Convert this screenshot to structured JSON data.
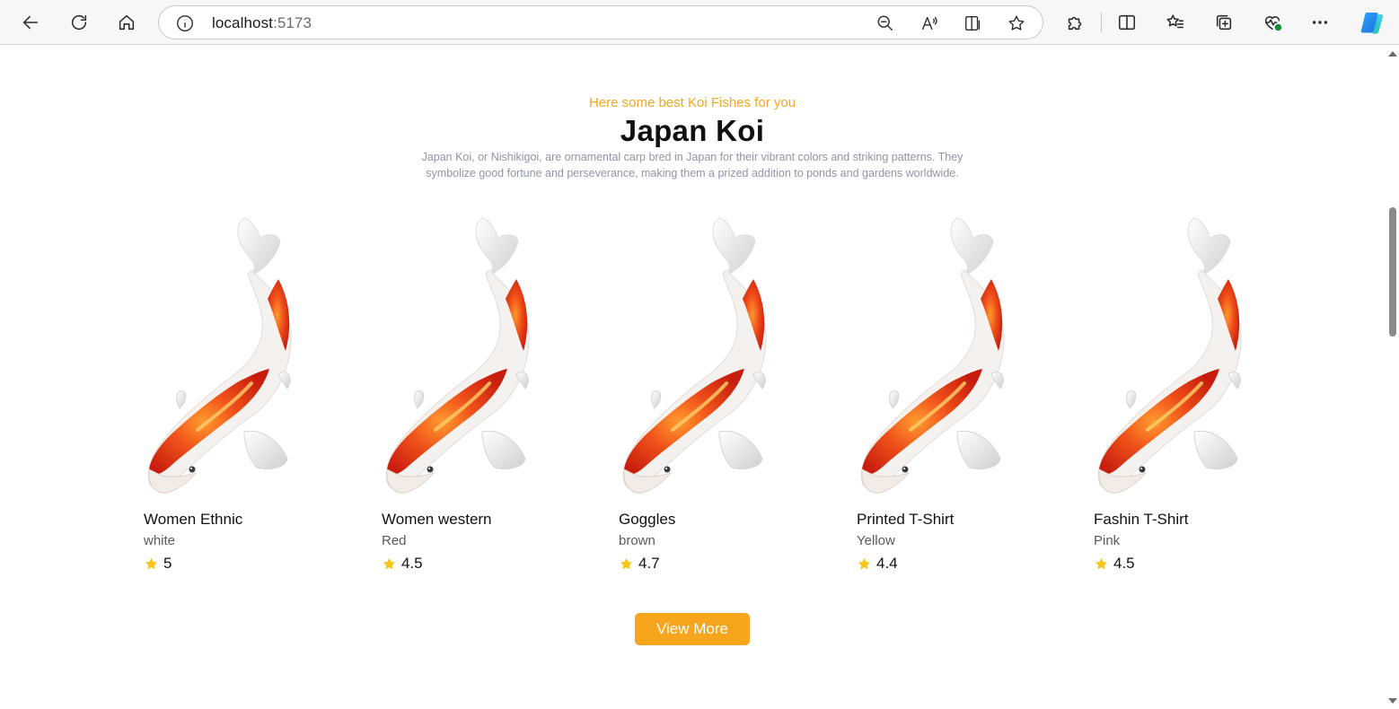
{
  "browser": {
    "url_host": "localhost",
    "url_port": ":5173"
  },
  "section": {
    "subtitle": "Here some best Koi Fishes for you",
    "title": "Japan Koi",
    "description": "Japan Koi, or Nishikigoi, are ornamental carp bred in Japan for their vibrant colors and striking patterns. They symbolize good fortune and perseverance, making them a prized addition to ponds and gardens worldwide."
  },
  "products": [
    {
      "name": "Women Ethnic",
      "color": "white",
      "rating": "5"
    },
    {
      "name": "Women western",
      "color": "Red",
      "rating": "4.5"
    },
    {
      "name": "Goggles",
      "color": "brown",
      "rating": "4.7"
    },
    {
      "name": "Printed T-Shirt",
      "color": "Yellow",
      "rating": "4.4"
    },
    {
      "name": "Fashin T-Shirt",
      "color": "Pink",
      "rating": "4.5"
    }
  ],
  "actions": {
    "view_more": "View More"
  },
  "colors": {
    "accent": "#f7a51c",
    "subtitle": "#f5a623",
    "star": "#f5c518"
  }
}
